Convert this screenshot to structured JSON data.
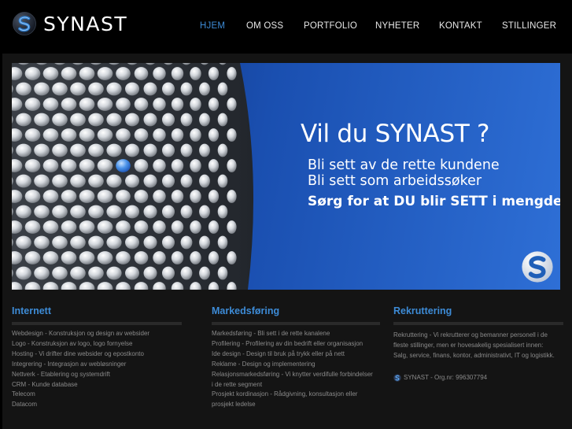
{
  "brand": {
    "name": "SYNAST"
  },
  "nav": [
    {
      "label": "HJEM",
      "active": true
    },
    {
      "label": "OM OSS"
    },
    {
      "label": "PORTFOLIO"
    },
    {
      "label": "NYHETER"
    },
    {
      "label": "KONTAKT"
    },
    {
      "label": "STILLINGER"
    }
  ],
  "banner": {
    "headline": "Vil du SYNAST ?",
    "line1": "Bli sett av de rette kundene",
    "line2": "Bli sett som arbeidssøker",
    "line3": "Sørg for at DU blir SETT i mengden!"
  },
  "columns": {
    "internett": {
      "title": "Internett",
      "items": [
        "Webdesign - Konstruksjon og design av websider",
        "Logo - Konstruksjon av logo, logo fornyelse",
        "Hosting - Vi drifter dine websider og epostkonto",
        "Integrering - Integrasjon av webløsninger",
        "Nettverk - Etablering og systemdrift",
        "CRM - Kunde database",
        "Telecom",
        "Datacom"
      ]
    },
    "markedsforing": {
      "title": "Markedsføring",
      "items": [
        "Markedsføring - Bli sett i de rette kanalene",
        "Profilering - Profilering av din bedrift eller organisasjon",
        "Ide design - Design til bruk på trykk eller på nett",
        "Reklame - Design og implementering",
        "Relasjonsmarkedsføring - Vi knytter verdifulle forbindelser",
        "i de rette segment",
        "Prosjekt kordinasjon - Rådgivning, konsultasjon eller",
        "prosjekt ledelse"
      ]
    },
    "rekruttering": {
      "title": "Rekruttering",
      "items": [
        "Rekruttering - Vi rekrutterer og bemanner personell i de",
        "fleste stillinger, men er hovesakelig spesialisert innen:",
        "Salg, service, finans, kontor, administrativt, IT og logistikk."
      ],
      "org": "SYNAST - Org.nr: 996307794"
    }
  },
  "colors": {
    "accent": "#3d8bd6",
    "background": "#000000",
    "panel": "#141414"
  }
}
